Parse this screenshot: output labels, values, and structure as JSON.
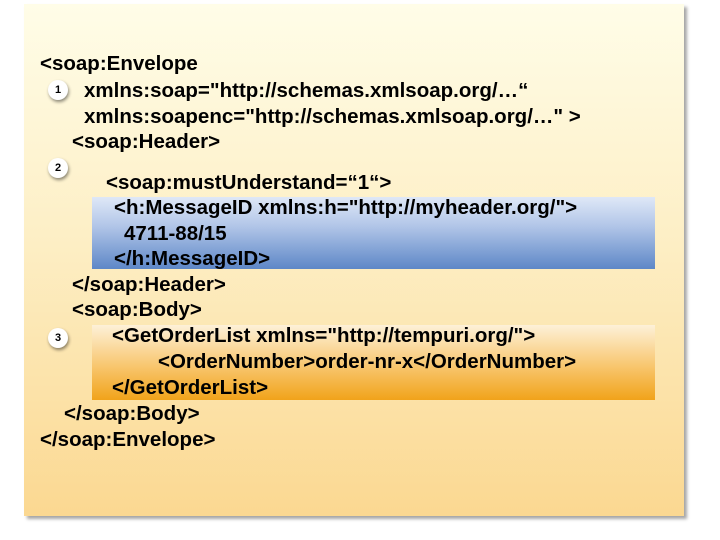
{
  "lines": [
    "<soap:Envelope",
    "xmlns:soap=\"http://schemas.xmlsoap.org/…“",
    "xmlns:soapenc=\"http://schemas.xmlsoap.org/…\" >",
    "<soap:Header>",
    "<soap:mustUnderstand=“1“>",
    "<h:MessageID xmlns:h=\"http://myheader.org/\">",
    "4711-88/15",
    "</h:MessageID>",
    "</soap:Header>",
    "<soap:Body>",
    "<GetOrderList xmlns=\"http://tempuri.org/\">",
    "<OrderNumber>order-nr-x</OrderNumber>",
    "</GetOrderList>",
    "</soap:Body>",
    "</soap:Envelope>"
  ],
  "badges": [
    "1",
    "2",
    "3"
  ],
  "colors": {
    "panel_top": "#fffde8",
    "panel_bottom": "#fbd891",
    "header_highlight": "#5d87c7",
    "body_highlight": "#f1a31a"
  }
}
